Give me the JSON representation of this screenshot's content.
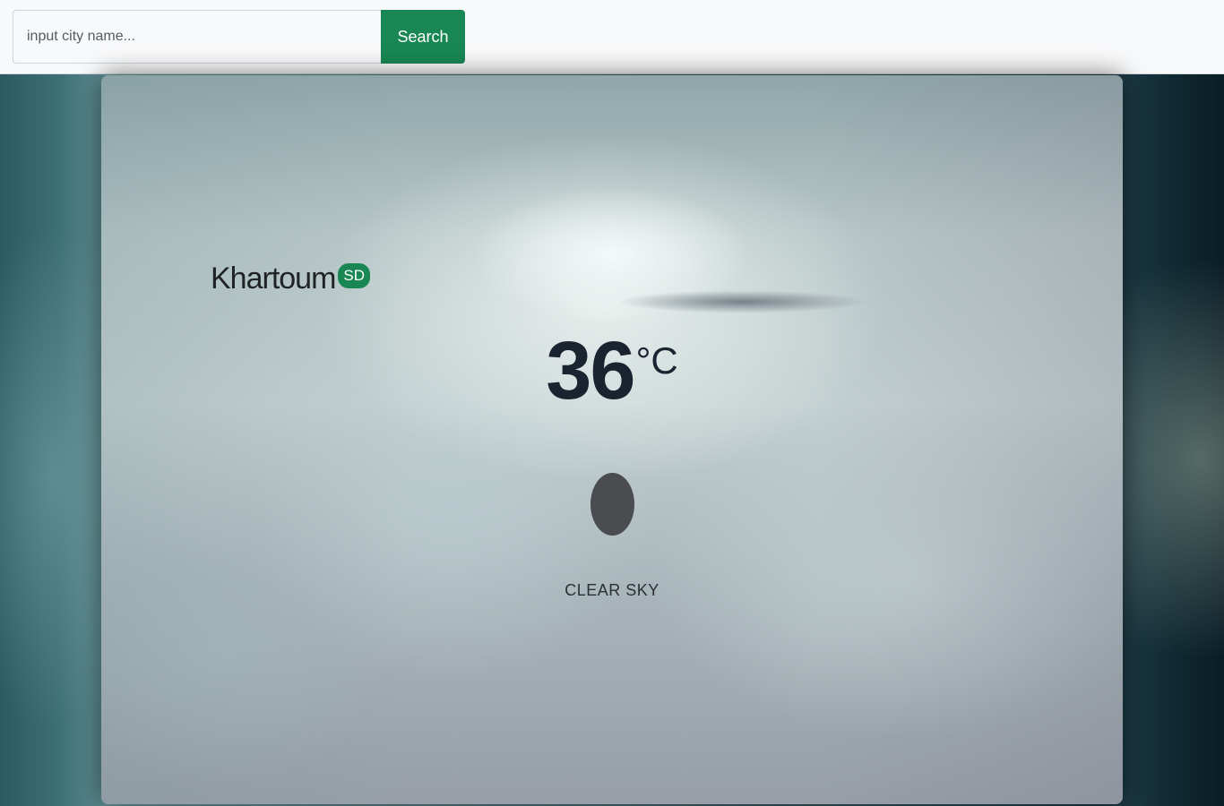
{
  "search": {
    "placeholder": "input city name...",
    "value": "",
    "button_label": "Search"
  },
  "weather": {
    "city": "Khartoum",
    "country_code": "SD",
    "temperature": "36",
    "unit": "°C",
    "description": "CLEAR SKY",
    "icon": "weather-condition-icon"
  },
  "colors": {
    "accent": "#198754",
    "text_dark": "#1b2230"
  }
}
